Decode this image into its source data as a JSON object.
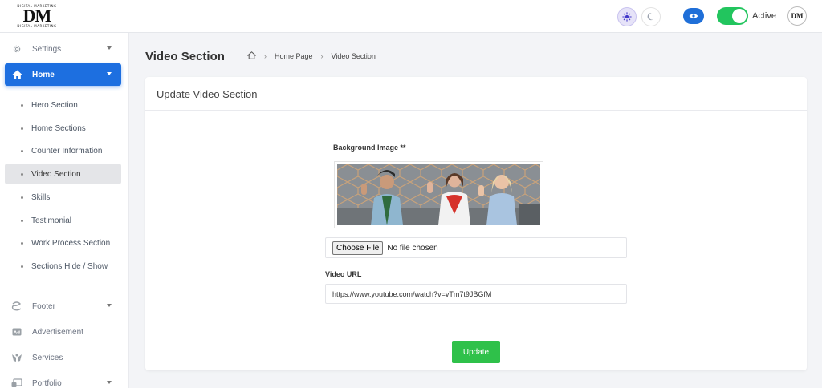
{
  "header": {
    "logo": {
      "top_text": "DIGITAL MARKETING",
      "mark": "DM",
      "bottom_text": "DIGITAL MARKETING"
    },
    "status_label": "Active",
    "avatar_text": "DM"
  },
  "sidebar": {
    "settings": "Settings",
    "home": "Home",
    "home_subitems": [
      "Hero Section",
      "Home Sections",
      "Counter Information",
      "Video Section",
      "Skills",
      "Testimonial",
      "Work Process Section",
      "Sections Hide / Show"
    ],
    "footer": "Footer",
    "advertisement": "Advertisement",
    "services": "Services",
    "portfolio": "Portfolio"
  },
  "page": {
    "title": "Video Section",
    "breadcrumb": [
      "Home Page",
      "Video Section"
    ]
  },
  "form": {
    "card_title": "Update Video Section",
    "bg_label": "Background Image **",
    "choose_file": "Choose File",
    "no_file": "No file chosen",
    "url_label": "Video URL",
    "url_value": "https://www.youtube.com/watch?v=vTm7t9JBGfM",
    "submit": "Update"
  },
  "colors": {
    "primary": "#1d6fe0",
    "success": "#2fc14a",
    "toggle_on": "#22c55e"
  }
}
